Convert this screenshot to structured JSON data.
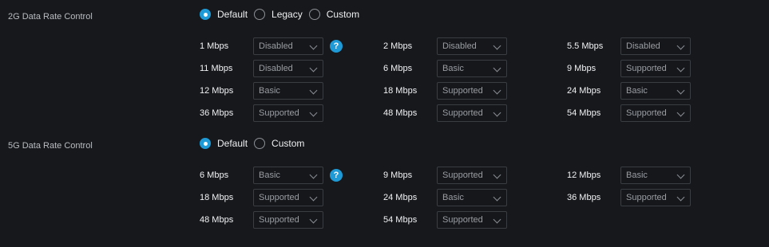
{
  "g2": {
    "label": "2G Data Rate Control",
    "options": [
      "Default",
      "Legacy",
      "Custom"
    ],
    "selected": "Default",
    "rates": [
      {
        "rate": "1 Mbps",
        "value": "Disabled"
      },
      {
        "rate": "2 Mbps",
        "value": "Disabled"
      },
      {
        "rate": "5.5 Mbps",
        "value": "Disabled"
      },
      {
        "rate": "11 Mbps",
        "value": "Disabled"
      },
      {
        "rate": "6 Mbps",
        "value": "Basic"
      },
      {
        "rate": "9 Mbps",
        "value": "Supported"
      },
      {
        "rate": "12 Mbps",
        "value": "Basic"
      },
      {
        "rate": "18 Mbps",
        "value": "Supported"
      },
      {
        "rate": "24 Mbps",
        "value": "Basic"
      },
      {
        "rate": "36 Mbps",
        "value": "Supported"
      },
      {
        "rate": "48 Mbps",
        "value": "Supported"
      },
      {
        "rate": "54 Mbps",
        "value": "Supported"
      }
    ]
  },
  "g5": {
    "label": "5G Data Rate Control",
    "options": [
      "Default",
      "Custom"
    ],
    "selected": "Default",
    "rates": [
      {
        "rate": "6 Mbps",
        "value": "Basic"
      },
      {
        "rate": "9 Mbps",
        "value": "Supported"
      },
      {
        "rate": "12 Mbps",
        "value": "Basic"
      },
      {
        "rate": "18 Mbps",
        "value": "Supported"
      },
      {
        "rate": "24 Mbps",
        "value": "Basic"
      },
      {
        "rate": "36 Mbps",
        "value": "Supported"
      },
      {
        "rate": "48 Mbps",
        "value": "Supported"
      },
      {
        "rate": "54 Mbps",
        "value": "Supported"
      }
    ]
  },
  "help_glyph": "?",
  "colors": {
    "accent": "#1f9ad6",
    "background": "#16181b"
  }
}
